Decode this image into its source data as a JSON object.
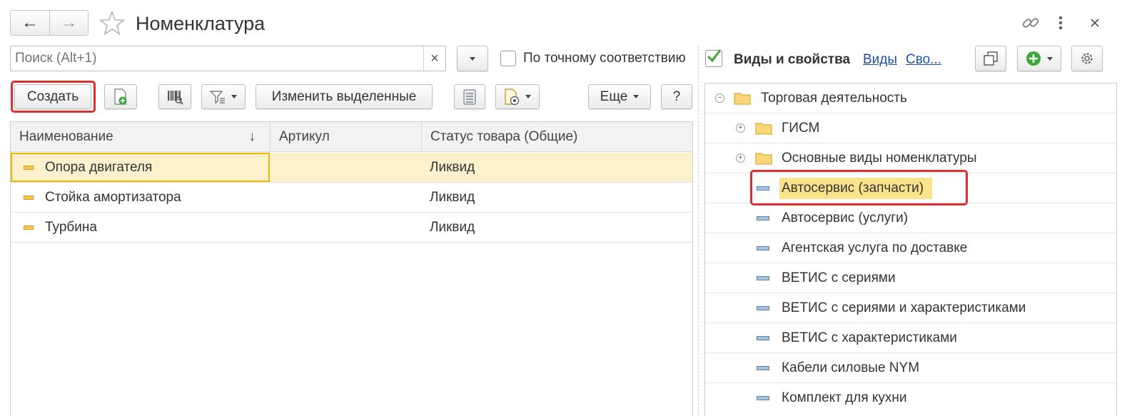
{
  "window": {
    "title": "Номенклатура",
    "back_label": "←",
    "forward_label": "→"
  },
  "search": {
    "placeholder": "Поиск (Alt+1)",
    "value": "",
    "clear_label": "×"
  },
  "exact_match": {
    "label": "По точному соответствию",
    "checked": false
  },
  "toolbar": {
    "create_label": "Создать",
    "edit_selected_label": "Изменить выделенные",
    "more_label": "Еще",
    "help_label": "?"
  },
  "table": {
    "columns": [
      "Наименование",
      "Артикул",
      "Статус товара (Общие)"
    ],
    "sort_indicator": "↓",
    "rows": [
      {
        "name": "Опора двигателя",
        "article": "",
        "status": "Ликвид"
      },
      {
        "name": "Стойка амортизатора",
        "article": "",
        "status": "Ликвид"
      },
      {
        "name": "Турбина",
        "article": "",
        "status": "Ликвид"
      }
    ]
  },
  "right_panel": {
    "title": "Виды и свойства",
    "link_kinds": "Виды",
    "link_props": "Сво...",
    "checked": true
  },
  "tree": {
    "root": {
      "label": "Торговая деятельность",
      "expander": "−"
    },
    "groups": [
      {
        "label": "ГИСМ",
        "expander": "+"
      },
      {
        "label": "Основные виды номенклатуры",
        "expander": "+"
      }
    ],
    "items": [
      "Автосервис (запчасти)",
      "Автосервис (услуги)",
      "Агентская услуга по доставке",
      "ВЕТИС с сериями",
      "ВЕТИС с сериями и характеристиками",
      "ВЕТИС с характеристиками",
      "Кабели силовые NYM",
      "Комплект для кухни"
    ],
    "selected_item": "Автосервис (запчасти)"
  },
  "colors": {
    "highlight_row": "#fbf2cd",
    "selected_cell_border": "#f0b400",
    "callout_red": "#d9302c",
    "accent_green": "#3aa83a",
    "link_blue": "#1f4fa8"
  }
}
